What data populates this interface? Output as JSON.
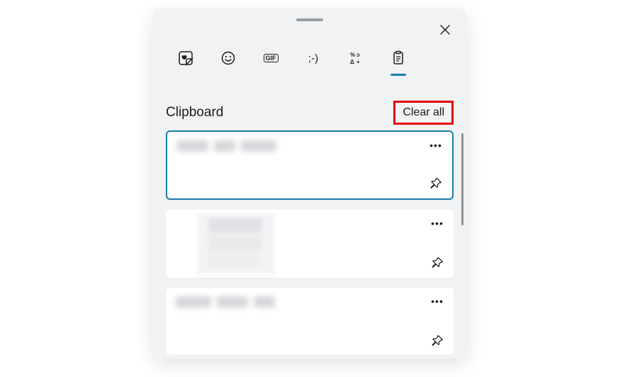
{
  "header": {
    "title": "Clipboard",
    "clear_all_label": "Clear all"
  },
  "tabs": [
    {
      "id": "recent",
      "name": "recent-tab",
      "glyph": "heart-sticker",
      "active": false
    },
    {
      "id": "emoji",
      "name": "emoji-tab",
      "glyph": "smiley",
      "active": false
    },
    {
      "id": "gif",
      "name": "gif-tab",
      "glyph": "gif",
      "active": false
    },
    {
      "id": "kaomoji",
      "name": "kaomoji-tab",
      "glyph": "kaomoji",
      "active": false
    },
    {
      "id": "symbols",
      "name": "symbols-tab",
      "glyph": "symbols",
      "active": false
    },
    {
      "id": "clipboard",
      "name": "clipboard-tab",
      "glyph": "clipboard",
      "active": true
    }
  ],
  "glyph_text": {
    "kaomoji": ";-)",
    "gif": "GIF"
  },
  "items": [
    {
      "type": "text",
      "selected": true,
      "more": "•••"
    },
    {
      "type": "image",
      "selected": false,
      "more": "•••"
    },
    {
      "type": "text",
      "selected": false,
      "more": "•••"
    }
  ],
  "annotations": {
    "clear_all_highlight": "#e60000"
  }
}
